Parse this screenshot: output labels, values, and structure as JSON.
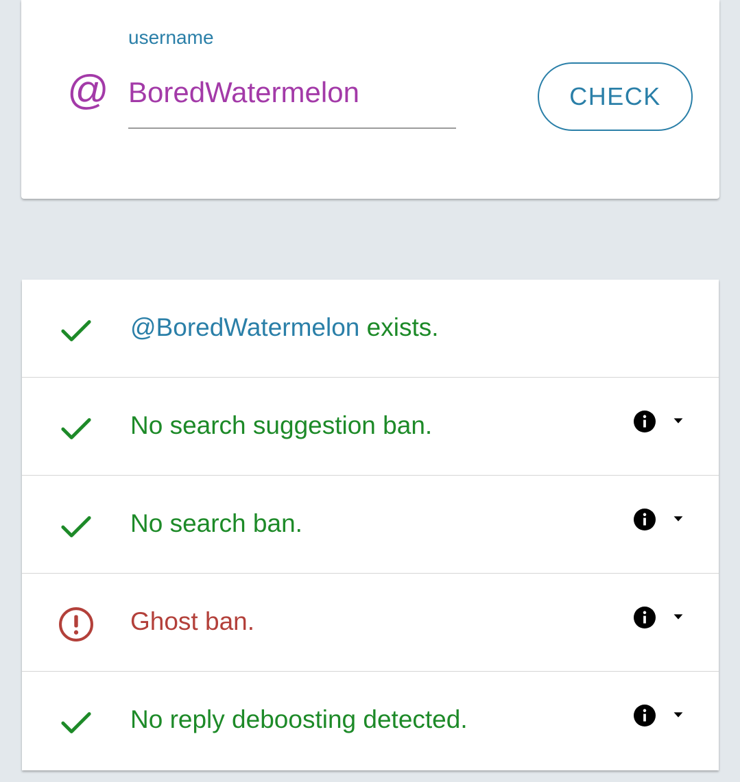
{
  "search": {
    "label": "username",
    "value": "BoredWatermelon",
    "prefix_icon": "at-sign-icon",
    "check_label": "CHECK"
  },
  "colors": {
    "accent_blue": "#2a7fa8",
    "accent_purple": "#a33aa8",
    "success_green": "#1d8a28",
    "error_red": "#b3403a",
    "background": "#e3e8ec"
  },
  "results": [
    {
      "status": "ok",
      "icon": "check-icon",
      "handle": "@BoredWatermelon",
      "text": " exists."
    },
    {
      "status": "ok",
      "icon": "check-icon",
      "text": "No search suggestion ban.",
      "info_icon": "info-icon",
      "toggle_icon": "caret-down-icon"
    },
    {
      "status": "ok",
      "icon": "check-icon",
      "text": "No search ban.",
      "info_icon": "info-icon",
      "toggle_icon": "caret-down-icon"
    },
    {
      "status": "error",
      "icon": "alert-circle-icon",
      "text": "Ghost ban.",
      "info_icon": "info-icon",
      "toggle_icon": "caret-down-icon"
    },
    {
      "status": "ok",
      "icon": "check-icon",
      "text": "No reply deboosting detected.",
      "info_icon": "info-icon",
      "toggle_icon": "caret-down-icon"
    }
  ]
}
